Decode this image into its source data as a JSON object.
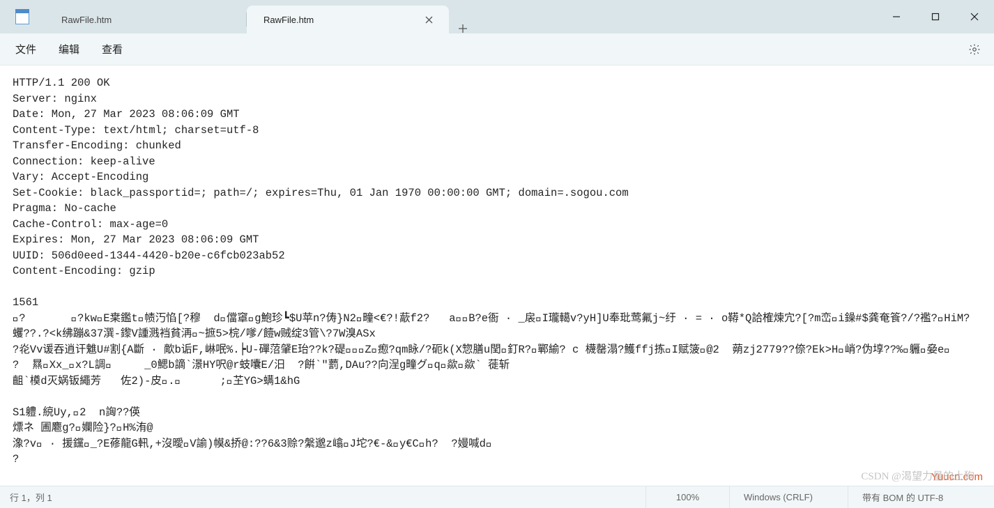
{
  "tabs": {
    "inactive": {
      "label": "RawFile.htm"
    },
    "active": {
      "label": "RawFile.htm"
    }
  },
  "menu": {
    "file": "文件",
    "edit": "编辑",
    "view": "查看"
  },
  "content": "HTTP/1.1 200 OK\nServer: nginx\nDate: Mon, 27 Mar 2023 08:06:09 GMT\nContent-Type: text/html; charset=utf-8\nTransfer-Encoding: chunked\nConnection: keep-alive\nVary: Accept-Encoding\nSet-Cookie: black_passportid=; path=/; expires=Thu, 01 Jan 1970 00:00:00 GMT; domain=.sogou.com\nPragma: No-cache\nCache-Control: max-age=0\nExpires: Mon, 27 Mar 2023 08:06:09 GMT\nUUID: 506d0eed-1344-4420-b20e-c6fcb023ab52\nContent-Encoding: gzip\n\n1561\n￿?       ￿?kw￿E枽鑑t￿帻汅惂[?穆  d￿儅窧￿g鮑珍┗$U苹n?俦}N2￿疃<€?!藃f2?   a￿￿B?e衙 · _扆￿I瓏轕v?yH]U奉玭莺氟j~纡 · = · o鞯*Q詥榷煉宂?[?m峦￿i鐰#$龚奄篒?/?襤?￿HiM?蠼??.?<k绋蹦&37潠-鑗V諥溅裆貧洅￿~摭5>梡/嗲/饐w贼绽3管\\?7W溴ASx\n?炛Vv谖吞逍讦魋U#割{A斷 · 歒b诟F,崊呡%.┝U-磾菬肈E珆??k?碮￿￿￿Z￿瘛?qm眿/?砈k(X惣膳u閏￿釘R?￿鄲緰? c 櫗罄溻?鱯ffj拣￿I赋箥￿@2  蒴zj2779??倷?Ek>H￿峭?伪埻??%￿軅￿姭e￿       ?  㬎￿Xx_￿x?L調￿     _0鰓b謫`澋HY呎@r蚑囔E/汨  ?餠`\"藅,DAu??向浧g疃グ￿q￿歘￿歘` 蓰斩\n齟`橂d灭娲钣繩芳   佐2)-皮￿.￿      ;￿芏YG>螨1&hG\n\nS1軆.綂Uy,￿2  n詾??偀\n熛ネ 圃麅g?￿孄险}?￿H%洧@\n潒?v￿ · 援钂￿_?E蓚龍G軐,+沒曖￿V諭)幙&挢@:??6&3赊?縏邈z嶖￿J坨?€-&￿y€C￿h?  ?嫚喊d￿\n?",
  "status": {
    "cursor": "行 1，列 1",
    "zoom": "100%",
    "eol": "Windows (CRLF)",
    "encoding": "带有 BOM 的 UTF-8"
  },
  "watermarks": {
    "csdn": "CSDN @渴望力量的土狗",
    "site": "Yuucn.com"
  }
}
